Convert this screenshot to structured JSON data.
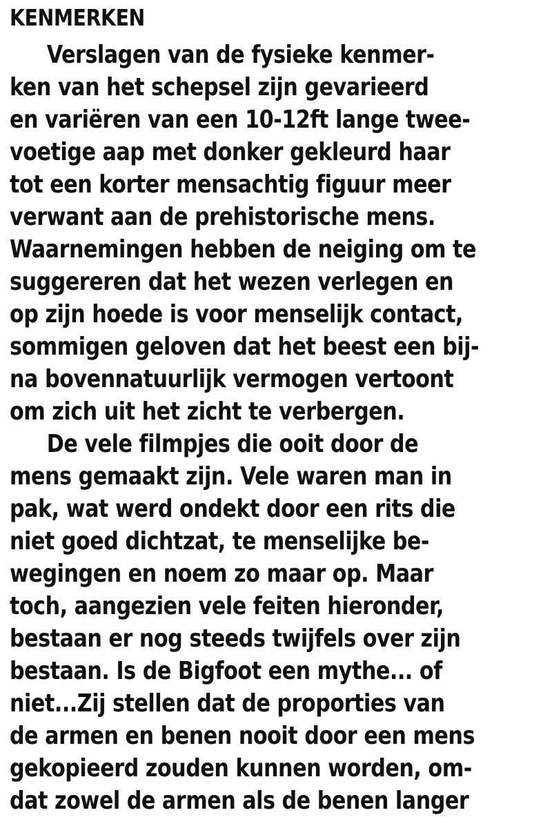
{
  "heading": "KENMERKEN",
  "lines": [
    "Verslagen van de fysieke kenmer-",
    "ken van het schepsel zijn gevarieerd",
    "en variëren van een 10-12ft lange twee-",
    "voetige aap met donker gekleurd haar",
    "tot een korter mensachtig figuur meer",
    "verwant aan de prehistorische mens.",
    "Waarnemingen hebben de neiging om te",
    "suggereren dat het wezen verlegen en",
    "op zijn hoede is voor menselijk contact,",
    "sommigen geloven dat het beest een bij-",
    "na bovennatuurlijk vermogen vertoont",
    "om zich uit het zicht te verbergen.",
    "De vele filmpjes die ooit door de",
    "mens gemaakt zijn. Vele waren man in",
    "pak, wat werd ondekt door een rits die",
    "niet goed dichtzat, te menselijke be-",
    "wegingen en noem zo maar op. Maar",
    "toch, aangezien vele feiten hieronder,",
    "bestaan er nog steeds twijfels over zijn",
    "bestaan. Is de Bigfoot een mythe... of",
    "niet...Zij stellen dat de proporties van",
    "de armen en benen nooit door een mens",
    "gekopieerd zouden kunnen worden, om-",
    "dat zowel de armen als de benen langer"
  ]
}
